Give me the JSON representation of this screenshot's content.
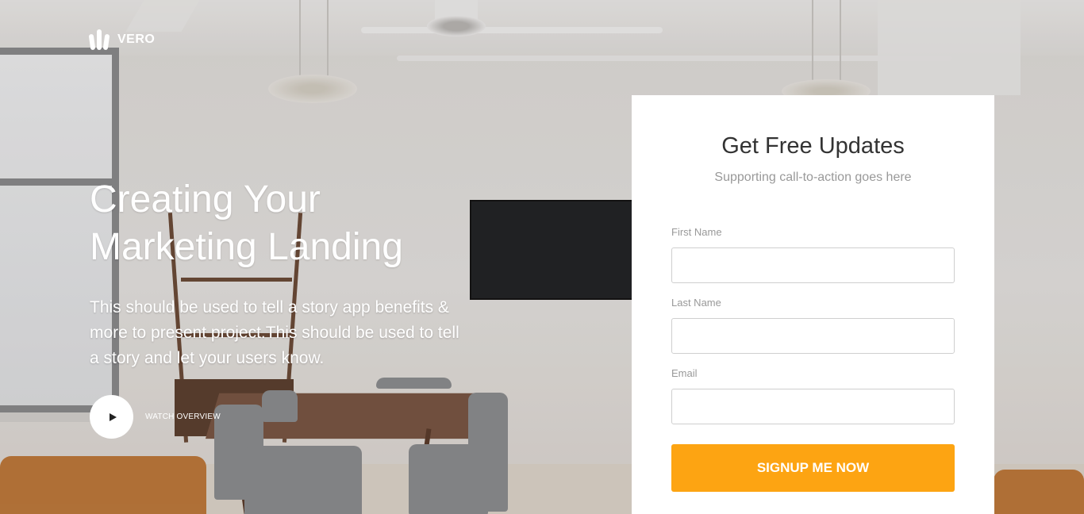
{
  "brand": {
    "name": "VERO",
    "logo_icon": "logo-bars-icon"
  },
  "hero": {
    "title_line1": "Creating Your",
    "title_line2": "Marketing Landing",
    "description": "This should be used to tell a story app benefits & more to present project.This should be used to tell a story and let your users know.",
    "watch_label": "WATCH OVERVIEW",
    "watch_icon": "play-icon"
  },
  "signup": {
    "title": "Get Free Updates",
    "subtitle": "Supporting call-to-action goes here",
    "fields": [
      {
        "label": "First Name",
        "value": "",
        "placeholder": ""
      },
      {
        "label": "Last Name",
        "value": "",
        "placeholder": ""
      },
      {
        "label": "Email",
        "value": "",
        "placeholder": ""
      }
    ],
    "submit_label": "SIGNUP ME NOW"
  },
  "colors": {
    "accent": "#fda412",
    "card_background": "#ffffff",
    "title_text": "#333333",
    "muted_text": "#999999"
  }
}
